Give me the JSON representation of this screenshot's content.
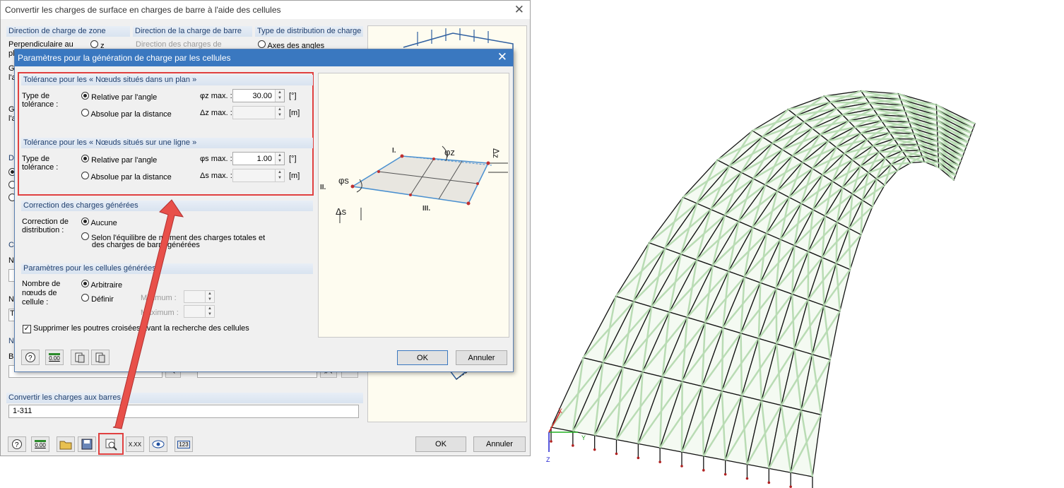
{
  "parent": {
    "title": "Convertir les charges de surface en charges de barre à l'aide des cellules",
    "close_glyph": "✕",
    "groups": {
      "zone_dir": "Direction de charge de zone",
      "bar_dir": "Direction de la charge de barre",
      "dist_type": "Type de distribution de charge"
    },
    "perp_label": "Perpendiculaire au",
    "z_label": "z",
    "bar_dir_text": "Direction des charges de",
    "axes_angles": "Axes des angles",
    "fragments": {
      "pl": "pl",
      "gl1": "Gl",
      "la1": "l'a",
      "gl2": "Gl",
      "la2": "l'a",
      "di": "Di",
      "ce": "Ce",
      "nc1": "No",
      "nc2": "No",
      "t": "T",
      "ne": "Ne",
      "ba": "Ba"
    },
    "convert_label": "Convertir les charges aux barres n°",
    "convert_value": "1-311",
    "ok": "OK",
    "cancel": "Annuler",
    "toolbar_zero": "0.00",
    "toolbar_xxx": "X.XX",
    "toolbar_123": "123"
  },
  "child": {
    "title": "Paramètres pour la génération de charge par les cellules",
    "close_glyph": "✕",
    "tol_plane": {
      "heading": "Tolérance pour les « Nœuds situés dans un plan »",
      "type_label1": "Type de",
      "type_label2": "tolérance :",
      "relative": "Relative par l'angle",
      "absolute": "Absolue par la distance",
      "phi_label": "φz max. :",
      "phi_value": "30.00",
      "phi_unit": "[°]",
      "delta_label": "Δz max. :",
      "delta_unit": "[m]"
    },
    "tol_line": {
      "heading": "Tolérance pour les « Nœuds situés sur une ligne »",
      "type_label1": "Type de",
      "type_label2": "tolérance :",
      "relative": "Relative par l'angle",
      "absolute": "Absolue par la distance",
      "phi_label": "φs max. :",
      "phi_value": "1.00",
      "phi_unit": "[°]",
      "delta_label": "Δs max. :",
      "delta_unit": "[m]"
    },
    "correction": {
      "heading": "Correction des charges générées",
      "label1": "Correction de",
      "label2": "distribution :",
      "opt1": "Aucune",
      "opt2a": "Selon l'équilibre de moment des charges totales et",
      "opt2b": "des charges de barre générées"
    },
    "cells": {
      "heading": "Paramètres pour les cellules générées",
      "label1": "Nombre de",
      "label2": "nœuds de",
      "label3": "cellule :",
      "opt1": "Arbitraire",
      "opt2": "Définir",
      "min_label": "Minimum :",
      "max_label": "Maximum :"
    },
    "suppress": "Supprimer les poutres croisées avant la recherche des cellules",
    "diagram_labels": {
      "p1": "I.",
      "p2": "II.",
      "p3": "III.",
      "phiz": "φz",
      "phis": "φs",
      "ds": "Δs",
      "dz": "Δz"
    },
    "ok": "OK",
    "cancel": "Annuler",
    "toolbar_zero": "0.00"
  },
  "axes": {
    "x": "X",
    "y": "Y",
    "z": "Z"
  },
  "colors": {
    "title_active": "#3a78c0",
    "highlight": "#e04040",
    "arrow": "#e8504a",
    "mesh_fill": "#b9dcb4"
  }
}
